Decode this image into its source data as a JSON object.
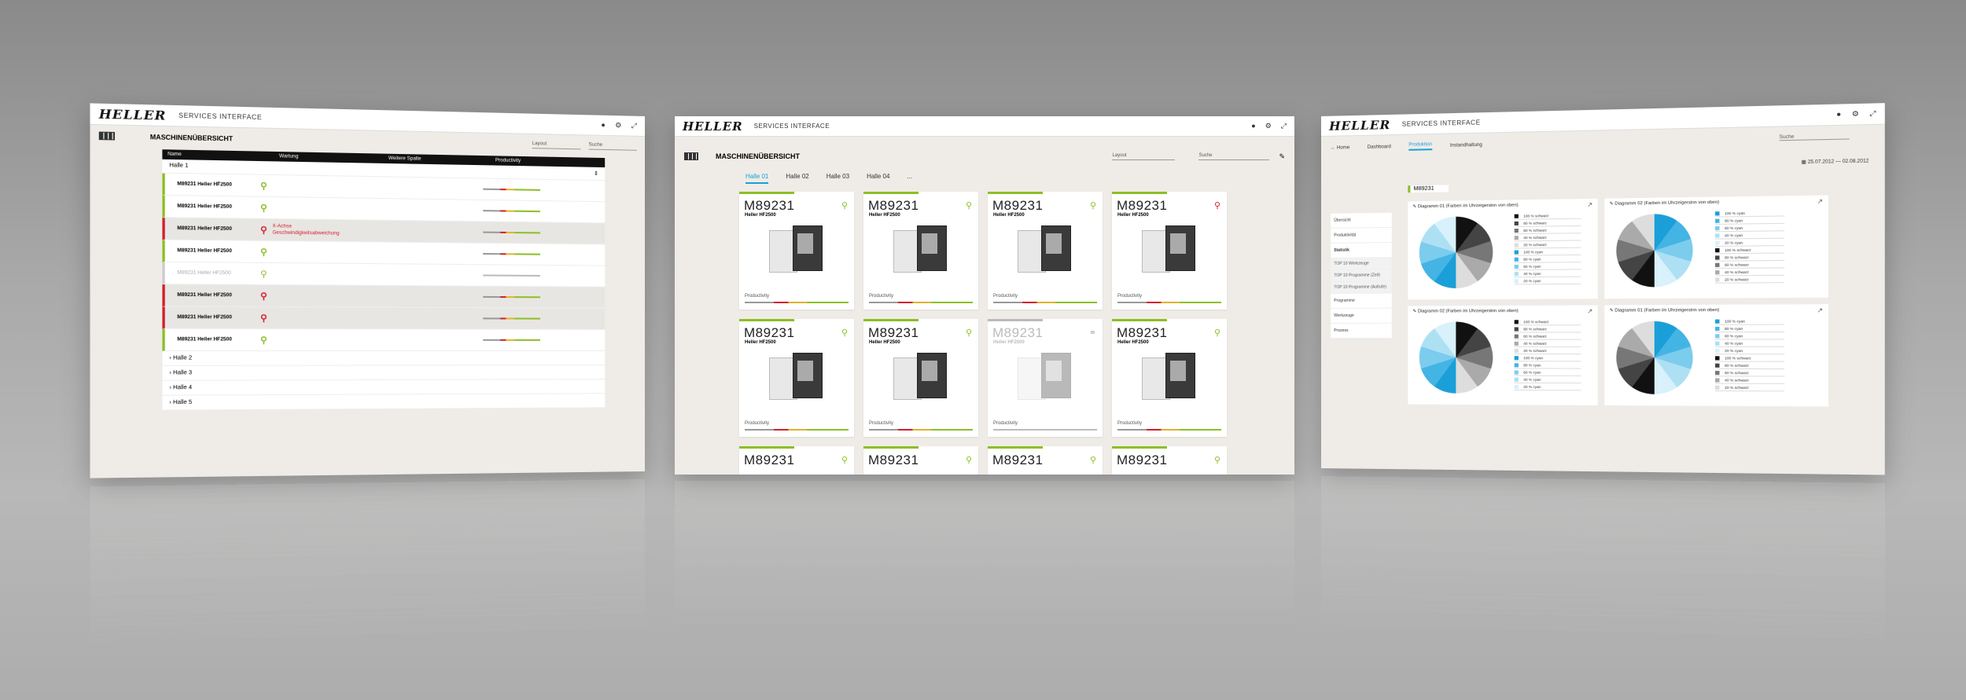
{
  "brand": "HELLER",
  "app_name": "SERVICES INTERFACE",
  "left": {
    "title": "MASCHINENÜBERSICHT",
    "layout_placeholder": "Layout",
    "search_placeholder": "Suche",
    "columns": [
      "Name",
      "Wartung",
      "Weitere Spalte",
      "Productivity"
    ],
    "open_group": "Halle 1",
    "rows": [
      {
        "name": "M89231 Heller HF2500",
        "state": "g"
      },
      {
        "name": "M89231 Heller HF2500",
        "state": "g"
      },
      {
        "name": "M89231 Heller HF2500",
        "state": "r",
        "err1": "X-Achse",
        "err2": "Geschwindigkeitsabweichung"
      },
      {
        "name": "M89231 Heller HF2500",
        "state": "g"
      },
      {
        "name": "M89231 Heller HF2500",
        "state": "grey"
      },
      {
        "name": "M89231 Heller HF2500",
        "state": "r"
      },
      {
        "name": "M89231 Heller HF2500",
        "state": "r"
      },
      {
        "name": "M89231 Heller HF2500",
        "state": "g"
      }
    ],
    "groups": [
      "Halle 2",
      "Halle 3",
      "Halle 4",
      "Halle 5"
    ]
  },
  "mid": {
    "title": "MASCHINENÜBERSICHT",
    "layout_placeholder": "Layout",
    "search_placeholder": "Suche",
    "tabs": [
      "Halle 01",
      "Halle 02",
      "Halle 03",
      "Halle 04",
      "..."
    ],
    "active_tab": 0,
    "productivity_label": "Productivity",
    "cards": [
      {
        "id": "M89231",
        "type": "Heller HF2500",
        "icon": "ok"
      },
      {
        "id": "M89231",
        "type": "Heller HF2500",
        "icon": "ok"
      },
      {
        "id": "M89231",
        "type": "Heller HF2500",
        "icon": "ok"
      },
      {
        "id": "M89231",
        "type": "Heller HF2500",
        "icon": "alert"
      },
      {
        "id": "M89231",
        "type": "Heller HF2500",
        "icon": "ok"
      },
      {
        "id": "M89231",
        "type": "Heller HF2500",
        "icon": "ok"
      },
      {
        "id": "M89231",
        "type": "Heller HF2500",
        "icon": "off"
      },
      {
        "id": "M89231",
        "type": "Heller HF2500",
        "icon": "ok"
      },
      {
        "id": "M89231",
        "type": "",
        "icon": "ok"
      },
      {
        "id": "M89231",
        "type": "",
        "icon": "ok"
      },
      {
        "id": "M89231",
        "type": "",
        "icon": "ok"
      },
      {
        "id": "M89231",
        "type": "",
        "icon": "ok"
      }
    ]
  },
  "right": {
    "back": "Home",
    "nav": [
      "Dashboard",
      "Produktion",
      "Instandhaltung"
    ],
    "active_nav": 1,
    "search_placeholder": "Suche",
    "date_range": "25.07.2012 — 02.08.2012",
    "machine_select": "M89231",
    "menu": [
      "Übersicht",
      "Produktivität",
      "Statistik",
      "TOP 10 Werkzeuge",
      "TOP 10 Programme (Zeit)",
      "TOP 10 Programme (Aufrufe)",
      "Programme",
      "Werkzeuge",
      "Prozess"
    ],
    "panels": [
      {
        "title": "Diagramm 01 (Farben im Uhrzeigersinn von oben)"
      },
      {
        "title": "Diagramm 02 (Farben im Uhrzeigersinn von oben)"
      },
      {
        "title": "Diagramm 02 (Farben im Uhrzeigersinn von oben)"
      },
      {
        "title": "Diagramm 01 (Farben im Uhrzeigersinn von oben)"
      }
    ],
    "legend_a": [
      "100 % schwarz",
      "80 % schwarz",
      "60 % schwarz",
      "40 % schwarz",
      "20 % schwarz",
      "100 % cyan",
      "80 % cyan",
      "60 % cyan",
      "40 % cyan",
      "20 % cyan"
    ],
    "legend_b": [
      "100 % cyan",
      "80 % cyan",
      "60 % cyan",
      "40 % cyan",
      "20 % cyan",
      "100 % schwarz",
      "80 % schwarz",
      "60 % schwarz",
      "40 % schwarz",
      "20 % schwarz"
    ]
  },
  "colors": {
    "accent_green": "#8cbf26",
    "alert_red": "#d21f2b",
    "cyan": "#1a9fd8"
  }
}
